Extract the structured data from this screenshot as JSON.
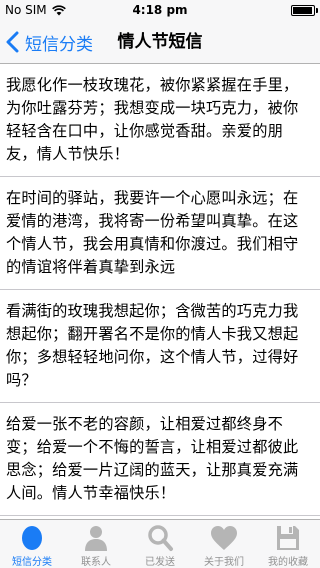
{
  "status_bar": {
    "carrier": "No SIM",
    "time": "4:18 pm",
    "battery_level": 0.95
  },
  "nav": {
    "back_label": "短信分类",
    "title": "情人节短信"
  },
  "messages": [
    {
      "text": "我愿化作一枝玫瑰花，被你紧紧握在手里，为你吐露芬芳；我想变成一块巧克力，被你轻轻含在口中，让你感觉香甜。亲爱的朋友，情人节快乐！"
    },
    {
      "text": "在时间的驿站，我要许一个心愿叫永远；在爱情的港湾，我将寄一份希望叫真挚。在这个情人节，我会用真情和你渡过。我们相守的情谊将伴着真挚到永远"
    },
    {
      "text": "看满街的玫瑰我想起你；含微苦的巧克力我想起你；翻开署名不是你的情人卡我又想起你；多想轻轻地问你，这个情人节，过得好吗？"
    },
    {
      "text": "给爱一张不老的容颜，让相爱过都终身不变；给爱一个不悔的誓言，让相爱过都彼此思念；给爱一片辽阔的蓝天，让那真爱充满人间。情人节幸福快乐！"
    }
  ],
  "tabs": [
    {
      "label": "短信分类",
      "icon": "circle-icon",
      "active": true
    },
    {
      "label": "联系人",
      "icon": "person-icon",
      "active": false
    },
    {
      "label": "已发送",
      "icon": "search-icon",
      "active": false
    },
    {
      "label": "关于我们",
      "icon": "heart-icon",
      "active": false
    },
    {
      "label": "我的收藏",
      "icon": "floppy-disk-icon",
      "active": false
    }
  ],
  "colors": {
    "accent": "#1a7cf5",
    "inactive": "#929292",
    "bar_background": "#f7f7f8"
  }
}
